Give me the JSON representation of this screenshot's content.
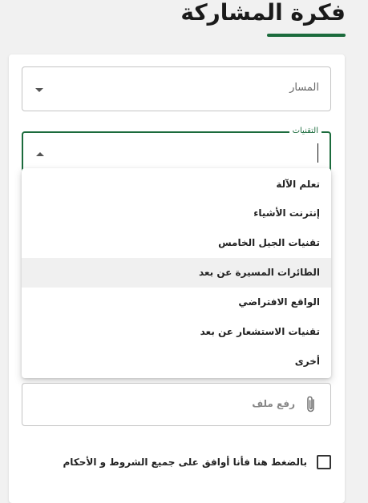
{
  "page": {
    "title": "فكرة المشاركة"
  },
  "form": {
    "path_field": {
      "placeholder": "المسار"
    },
    "tech_field": {
      "label": "التقنيات",
      "value": "",
      "options": [
        "تعلم الآلة",
        "إنترنت الأشياء",
        "تقنيات الجيل الخامس",
        "الطائرات المسيرة عن بعد",
        "الواقع الافتراضي",
        "تقنيات الاستشعار عن بعد",
        "أخرى"
      ],
      "hovered_option": "الطائرات المسيرة عن بعد"
    },
    "upload": {
      "label": "رفع ملف"
    },
    "terms": {
      "label": "بالضغط هنا فأنا أوافق على جميع الشروط و الأحكام",
      "checked": false
    }
  },
  "colors": {
    "accent": "#1b6b3c",
    "background": "#f1f1f1"
  },
  "icons": {
    "path_caret": "chevron-down-icon",
    "tech_caret": "chevron-up-icon",
    "upload": "paperclip-icon"
  }
}
